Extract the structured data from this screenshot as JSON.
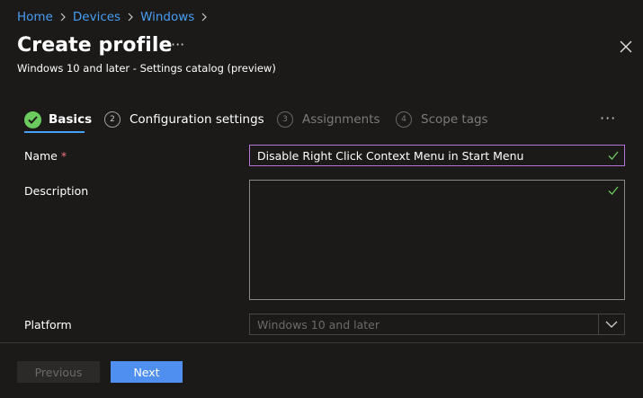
{
  "breadcrumb": {
    "items": [
      "Home",
      "Devices",
      "Windows"
    ]
  },
  "header": {
    "title": "Create profile",
    "more_label": "···",
    "subtitle": "Windows 10 and later - Settings catalog (preview)"
  },
  "wizard": {
    "tabs": [
      {
        "number": "",
        "label": "Basics",
        "state": "completed-active"
      },
      {
        "number": "2",
        "label": "Configuration settings",
        "state": "enabled"
      },
      {
        "number": "3",
        "label": "Assignments",
        "state": "disabled"
      },
      {
        "number": "4",
        "label": "Scope tags",
        "state": "disabled"
      }
    ],
    "more_label": "···"
  },
  "form": {
    "name": {
      "label": "Name",
      "required_mark": "*",
      "value": "Disable Right Click Context Menu in Start Menu"
    },
    "description": {
      "label": "Description",
      "value": ""
    },
    "platform": {
      "label": "Platform",
      "value": "Windows 10 and later"
    }
  },
  "footer": {
    "previous_label": "Previous",
    "next_label": "Next"
  },
  "colors": {
    "background": "#1b1a19",
    "link": "#479ef5",
    "accent_button": "#4f8fef",
    "success_green": "#6ccb5f",
    "focus_border": "#b473d6",
    "required_red": "#f1707b"
  },
  "icons": {
    "breadcrumb_separator": "chevron-right-icon",
    "close": "close-icon",
    "completed_step": "checkmark-circle-icon",
    "field_valid": "checkmark-icon",
    "dropdown": "chevron-down-icon"
  }
}
